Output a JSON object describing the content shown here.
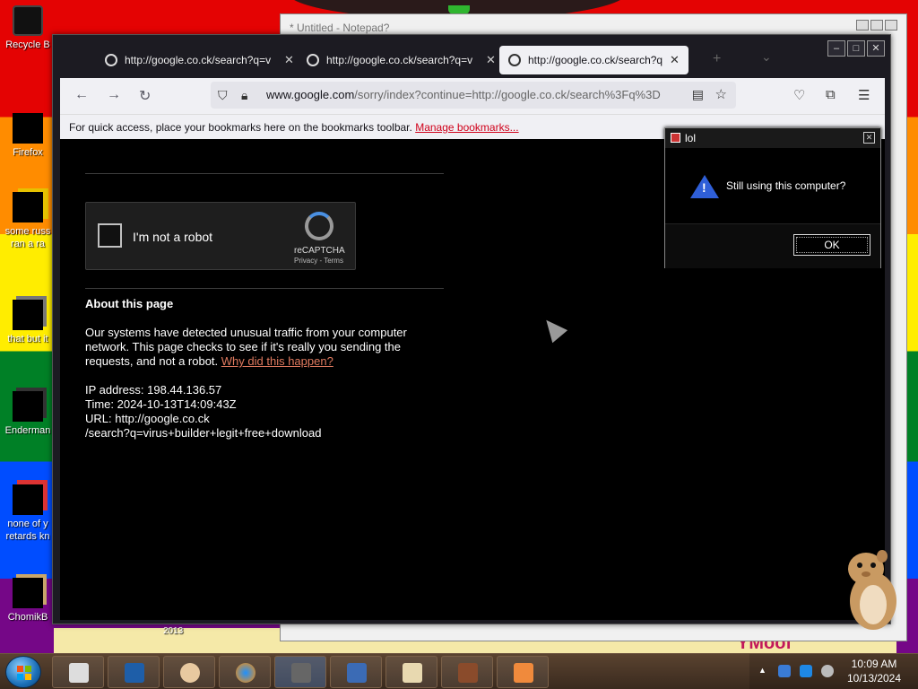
{
  "desktop": {
    "icons": [
      {
        "label": "Recycle B"
      },
      {
        "label": "Firefox"
      },
      {
        "label": "some russ",
        "label2": "ran a ra"
      },
      {
        "label": "that but it"
      },
      {
        "label": "Enderman"
      },
      {
        "label": "none of y",
        "label2": "retards kn"
      },
      {
        "label": "ChomikB"
      }
    ],
    "wallpaper_text": "2013",
    "wallpaper_text2": "YMoof"
  },
  "notepad": {
    "title": "* Untitled - Notepad?"
  },
  "browser": {
    "tabs": [
      {
        "title": "http://google.co.ck/search?q=v"
      },
      {
        "title": "http://google.co.ck/search?q=v"
      },
      {
        "title": "http://google.co.ck/search?q=v"
      }
    ],
    "url_host": "www.google.com",
    "url_rest": "/sorry/index?continue=http://google.co.ck/search%3Fq%3D",
    "bookmarks_bar_text": "For quick access, place your bookmarks here on the bookmarks toolbar.",
    "bookmarks_link": "Manage bookmarks...",
    "captcha": {
      "label": "I'm not a robot",
      "brand": "reCAPTCHA",
      "links": "Privacy - Terms"
    },
    "about": {
      "heading": "About this page",
      "para": "Our systems have detected unusual traffic from your computer network. This page checks to see if it's really you sending the requests, and not a robot.",
      "link": "Why did this happen?",
      "ip": "IP address: 198.44.136.57",
      "time": "Time: 2024-10-13T14:09:43Z",
      "url1": "URL: http://google.co.ck",
      "url2": "/search?q=virus+builder+legit+free+download"
    }
  },
  "dialog": {
    "title": "lol",
    "message": "Still using this computer?",
    "ok_label": "OK"
  },
  "taskbar": {
    "time": "10:09 AM",
    "date": "10/13/2024"
  },
  "colors": {
    "accent_link": "#e07a5f",
    "bookmark_link": "#d0021b",
    "warning_icon": "#2f5fd8"
  }
}
